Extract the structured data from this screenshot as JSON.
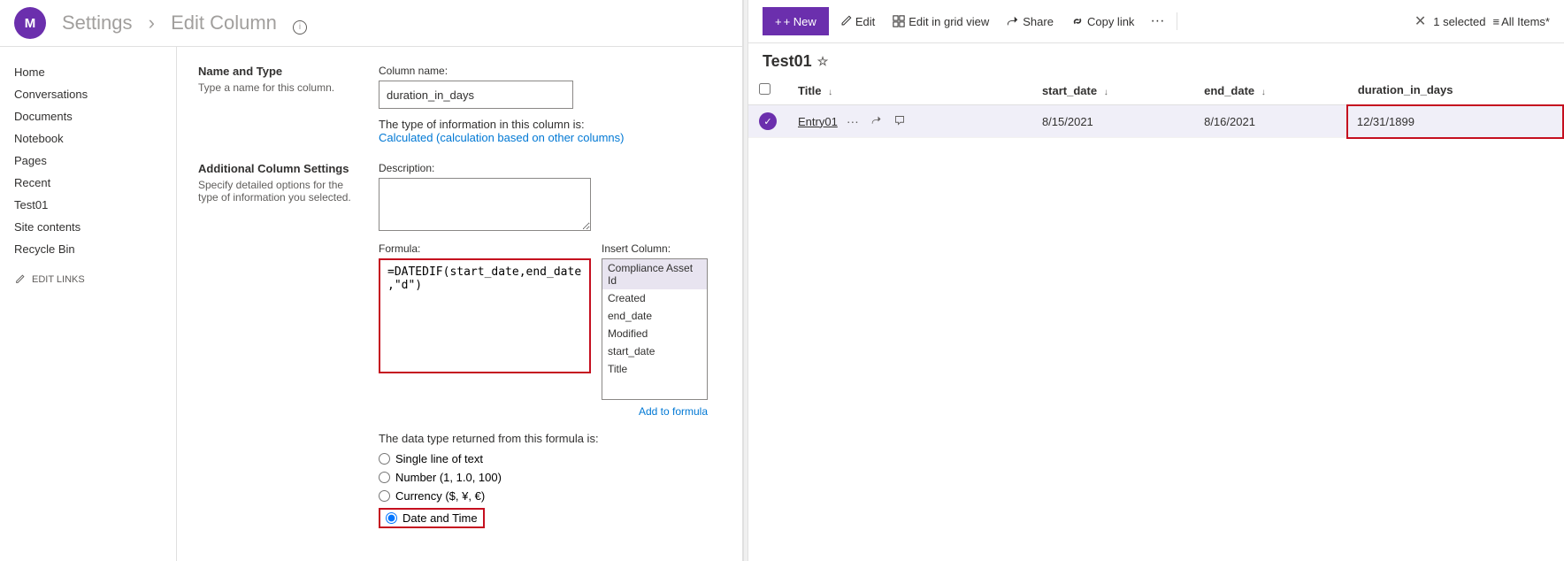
{
  "header": {
    "avatar_initial": "M",
    "breadcrumb_settings": "Settings",
    "breadcrumb_separator": "›",
    "breadcrumb_page": "Edit Column",
    "info_icon": "ⓘ"
  },
  "sidebar": {
    "links": [
      {
        "label": "Home",
        "name": "home",
        "active": false
      },
      {
        "label": "Conversations",
        "name": "conversations",
        "active": false
      },
      {
        "label": "Documents",
        "name": "documents",
        "active": false
      },
      {
        "label": "Notebook",
        "name": "notebook",
        "active": false
      },
      {
        "label": "Pages",
        "name": "pages",
        "active": false
      },
      {
        "label": "Recent",
        "name": "recent",
        "active": false
      },
      {
        "label": "Test01",
        "name": "test01",
        "active": false
      },
      {
        "label": "Site contents",
        "name": "site-contents",
        "active": false
      },
      {
        "label": "Recycle Bin",
        "name": "recycle-bin",
        "active": false
      }
    ],
    "edit_links_label": "EDIT LINKS"
  },
  "form": {
    "name_and_type_label": "Name and Type",
    "name_and_type_sub": "Type a name for this column.",
    "column_name_label": "Column name:",
    "column_name_value": "duration_in_days",
    "column_type_prefix": "The type of information in this column is:",
    "column_type_value": "Calculated (calculation based on other columns)",
    "additional_settings_label": "Additional Column Settings",
    "additional_settings_sub": "Specify detailed options for the type of information you selected.",
    "description_label": "Description:",
    "formula_label": "Formula:",
    "formula_value": "=DATEDIF(start_date,end_date,\"d\")",
    "insert_column_label": "Insert Column:",
    "column_list_items": [
      "Compliance Asset Id",
      "Created",
      "end_date",
      "Modified",
      "start_date",
      "Title"
    ],
    "add_to_formula_label": "Add to formula",
    "data_type_label": "The data type returned from this formula is:",
    "radio_options": [
      {
        "label": "Single line of text",
        "value": "text",
        "checked": false
      },
      {
        "label": "Number (1, 1.0, 100)",
        "value": "number",
        "checked": false
      },
      {
        "label": "Currency ($, ¥, €)",
        "value": "currency",
        "checked": false
      },
      {
        "label": "Date and Time",
        "value": "datetime",
        "checked": true
      }
    ]
  },
  "toolbar": {
    "new_label": "+ New",
    "edit_label": "Edit",
    "edit_grid_label": "Edit in grid view",
    "share_label": "Share",
    "copy_link_label": "Copy link",
    "more_icon": "···",
    "close_icon": "✕",
    "selected_label": "1 selected",
    "all_items_label": "All Items*",
    "filter_icon": "≡"
  },
  "list": {
    "title": "Test01",
    "columns": [
      {
        "label": "Title",
        "sort": "↓"
      },
      {
        "label": "start_date",
        "sort": "↓"
      },
      {
        "label": "end_date",
        "sort": "↓"
      },
      {
        "label": "duration_in_days",
        "sort": ""
      }
    ],
    "rows": [
      {
        "selected": true,
        "title": "Entry01",
        "start_date": "8/15/2021",
        "end_date": "8/16/2021",
        "duration_in_days": "12/31/1899"
      }
    ]
  }
}
